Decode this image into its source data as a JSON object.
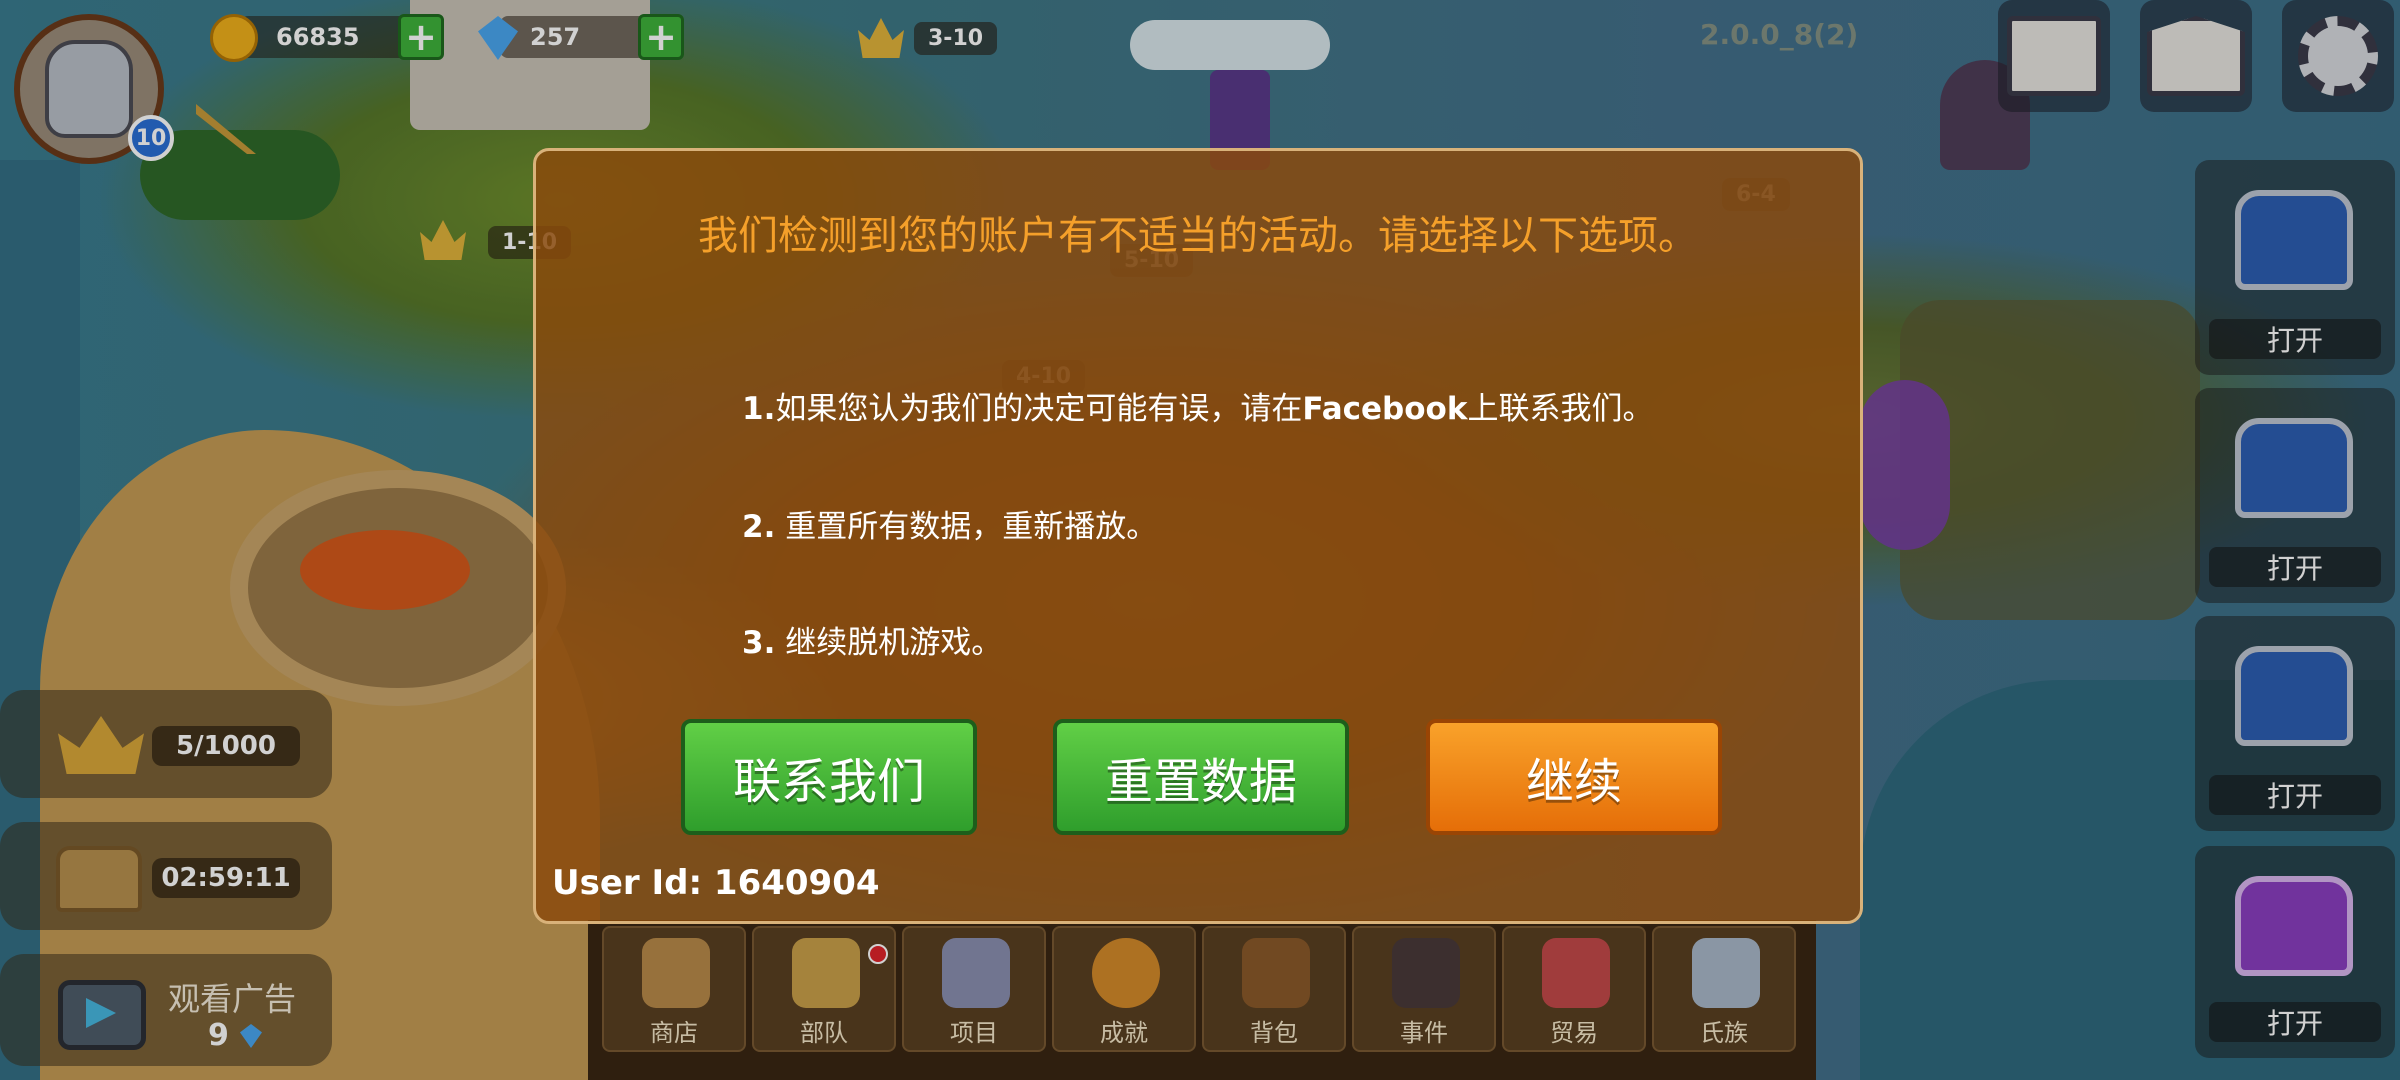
{
  "hud": {
    "player_level": "10",
    "coins": "66835",
    "gems": "257",
    "stage_badge": "3-10",
    "version": "2.0.0_8(2)",
    "map_stage_1": "1-10",
    "map_stage_2": "5-10",
    "map_stage_3": "4-10",
    "map_stage_4": "6-4"
  },
  "left_panel": {
    "crown_progress": "5/1000",
    "chest_timer": "02:59:11",
    "watch_ad_label": "观看广告",
    "watch_ad_gems": "9"
  },
  "chests": [
    {
      "label": "打开"
    },
    {
      "label": "打开"
    },
    {
      "label": "打开"
    },
    {
      "label": "打开"
    }
  ],
  "bottom_nav": [
    {
      "label": "商店",
      "icon": "shop-bag-icon",
      "color": "#b98a4a"
    },
    {
      "label": "部队",
      "icon": "troops-card-icon",
      "color": "#caa04a"
    },
    {
      "label": "项目",
      "icon": "sword-shield-icon",
      "color": "#8a8fb0"
    },
    {
      "label": "成就",
      "icon": "achievement-medal-icon",
      "color": "#d48a2a"
    },
    {
      "label": "背包",
      "icon": "backpack-icon",
      "color": "#8a5a2a"
    },
    {
      "label": "事件",
      "icon": "event-skull-gate-icon",
      "color": "#4a3a3a"
    },
    {
      "label": "贸易",
      "icon": "trade-shop-icon",
      "color": "#c44a4a"
    },
    {
      "label": "氏族",
      "icon": "clan-castle-icon",
      "color": "#a9b8c9"
    }
  ],
  "dialog": {
    "title": "我们检测到您的账户有不适当的活动。请选择以下选项。",
    "option1_num": "1.",
    "option1_pre": "如果您认为我们的决定可能有误，请在",
    "option1_bold": "Facebook",
    "option1_post": "上联系我们。",
    "option2_num": "2.",
    "option2_text": " 重置所有数据，重新播放。",
    "option3_num": "3.",
    "option3_text": " 继续脱机游戏。",
    "contact_button": "联系我们",
    "reset_button": "重置数据",
    "continue_button": "继续",
    "user_id": "User Id: 1640904"
  }
}
